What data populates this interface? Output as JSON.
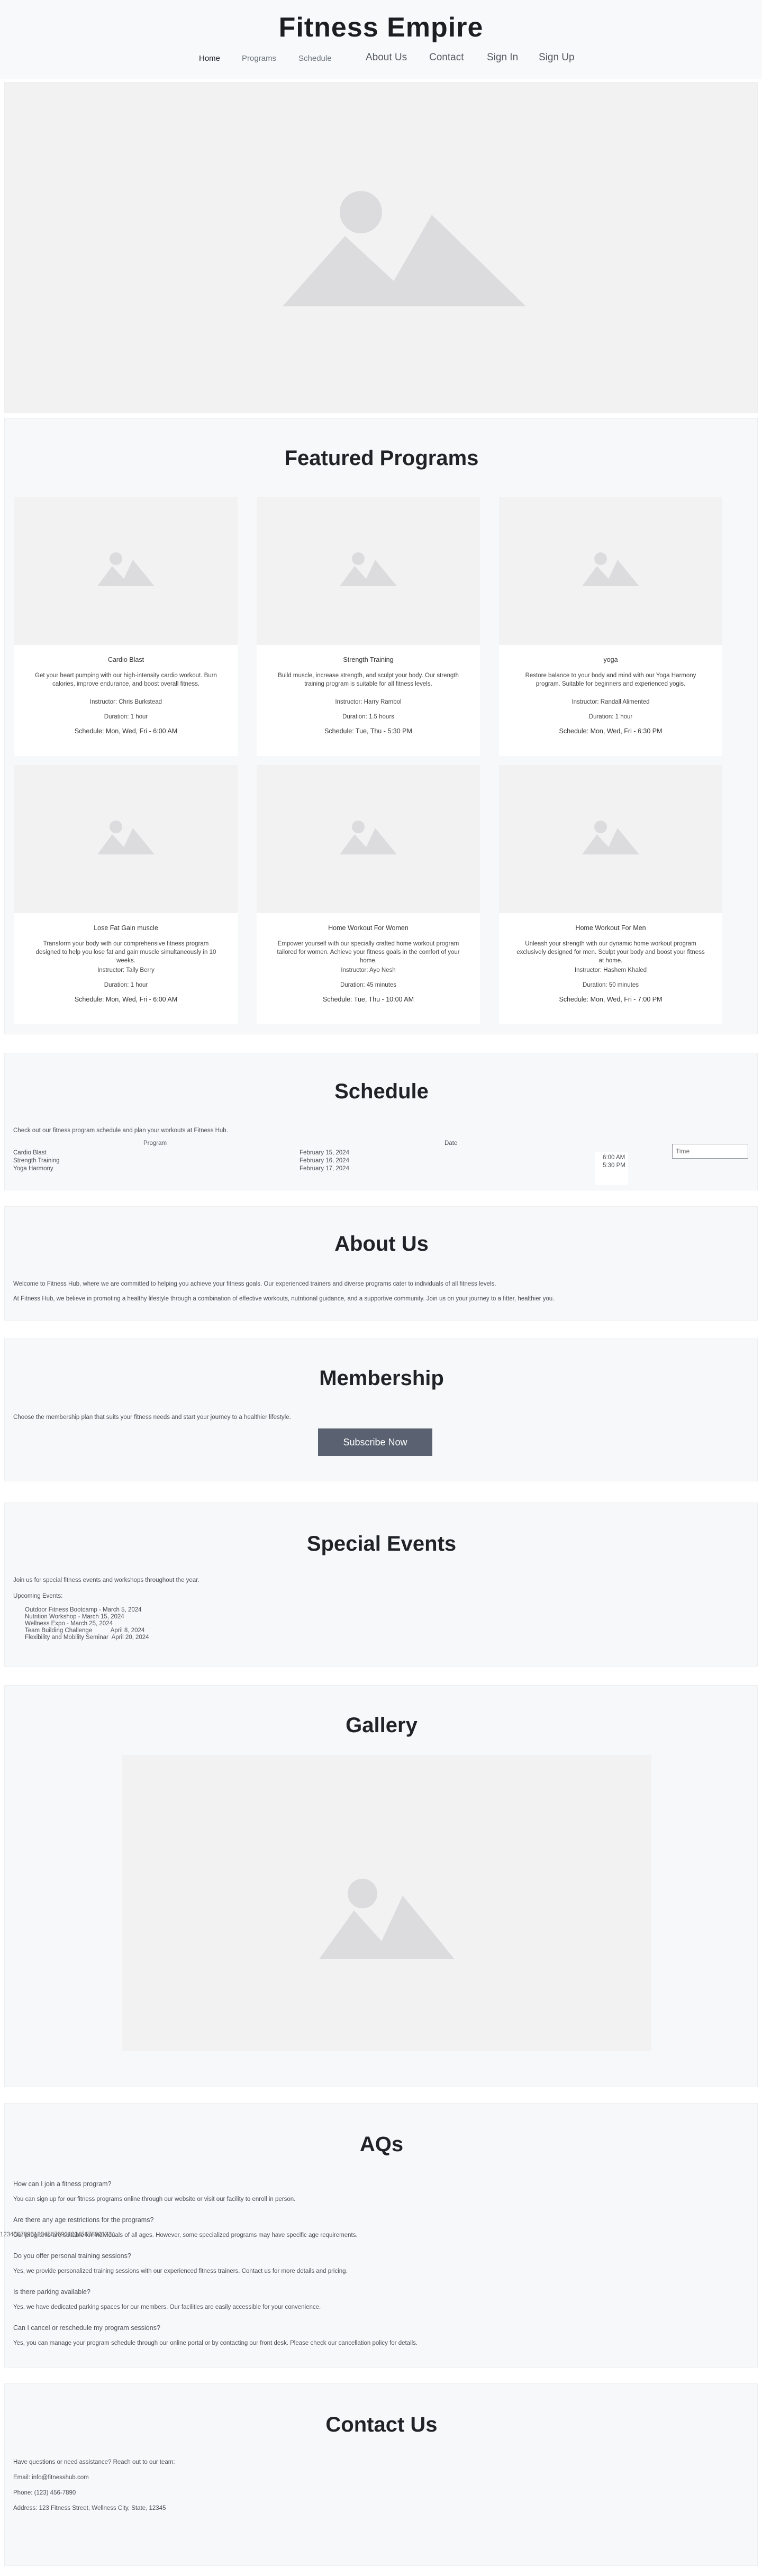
{
  "site": {
    "title": "Fitness Empire"
  },
  "nav": {
    "home": "Home",
    "programs": "Programs",
    "schedule": "Schedule",
    "about": "About Us",
    "contact": "Contact",
    "signin": "Sign In",
    "signup": "Sign Up"
  },
  "featured": {
    "title": "Featured Programs",
    "cards": [
      {
        "name": "Cardio Blast",
        "desc": "Get your heart pumping with our high-intensity cardio workout. Burn calories, improve endurance, and boost overall fitness.",
        "instructor": "Instructor: Chris Burkstead",
        "duration": "Duration: 1 hour",
        "schedule": "Schedule: Mon, Wed, Fri - 6:00 AM"
      },
      {
        "name": "Strength Training",
        "desc": "Build muscle, increase strength, and sculpt your body. Our strength training program is suitable for all fitness levels.",
        "instructor": "Instructor: Harry Rambol",
        "duration": "Duration: 1.5 hours",
        "schedule": "Schedule: Tue, Thu - 5:30 PM"
      },
      {
        "name": "yoga",
        "desc": "Restore balance to your body and mind with our Yoga Harmony program. Suitable for beginners and experienced yogis.",
        "instructor": "Instructor: Randall Alimented",
        "duration": "Duration: 1 hour",
        "schedule": "Schedule: Mon, Wed, Fri - 6:30 PM"
      },
      {
        "name": "Lose Fat Gain muscle",
        "desc": "Transform your body with our comprehensive fitness program designed to help you lose fat and gain muscle simultaneously in 10 weeks.",
        "instructor": "Instructor: Tally Berry",
        "duration": "Duration: 1 hour",
        "schedule": "Schedule: Mon, Wed, Fri - 6:00 AM"
      },
      {
        "name": "Home Workout For Women",
        "desc": "Empower yourself with our specially crafted home workout program tailored for women. Achieve your fitness goals in the comfort of your home.",
        "instructor": "Instructor: Ayo Nesh",
        "duration": "Duration: 45 minutes",
        "schedule": "Schedule: Tue, Thu - 10:00 AM"
      },
      {
        "name": "Home Workout For Men",
        "desc": "Unleash your strength with our dynamic home workout program exclusively designed for men. Sculpt your body and boost your fitness at home.",
        "instructor": "Instructor: Hashem Khaled",
        "duration": "Duration: 50 minutes",
        "schedule": "Schedule: Mon, Wed, Fri - 7:00 PM"
      }
    ]
  },
  "schedule": {
    "title": "Schedule",
    "intro": "Check out our fitness program schedule and plan your workouts at Fitness Hub.",
    "col_program": "Program",
    "col_date": "Date",
    "programs": [
      "Cardio Blast",
      "Strength Training",
      "Yoga Harmony"
    ],
    "dates": [
      "February 15, 2024",
      "February 16, 2024",
      "February 17, 2024"
    ],
    "times": [
      "6:00 AM",
      "5:30 PM"
    ],
    "time_placeholder": "Time"
  },
  "about": {
    "title": "About Us",
    "p1": "Welcome to Fitness Hub, where we are committed to helping you achieve your fitness goals. Our experienced trainers and diverse programs cater to individuals of all fitness levels.",
    "p2": "At Fitness Hub, we believe in promoting a healthy lifestyle through a combination of effective workouts, nutritional guidance, and a supportive community. Join us on your journey to a fitter, healthier you."
  },
  "membership": {
    "title": "Membership",
    "intro": "Choose the membership plan that suits your fitness needs and start your journey to a healthier lifestyle.",
    "button": "Subscribe Now"
  },
  "events": {
    "title": "Special Events",
    "intro": "Join us for special fitness events and workshops throughout the year.",
    "upcoming": "Upcoming Events:",
    "items": [
      "Outdoor Fitness Bootcamp - March 5, 2024",
      "Nutrition Workshop - March 15, 2024",
      "Wellness Expo - March 25, 2024",
      "Team Building Challenge           April 8, 2024",
      "Flexibility and Mobility Seminar  April 20, 2024"
    ]
  },
  "gallery": {
    "title": "Gallery"
  },
  "faq": {
    "title": "AQs",
    "overflow": "1234567890123456789012345678901234",
    "items": [
      {
        "q": "How can I join a fitness program?",
        "a": "You can sign up for our fitness programs online through our website or visit our facility to enroll in person."
      },
      {
        "q": "Are there any age restrictions for the programs?",
        "a": "Our programs are suitable for individuals of all ages. However, some specialized programs may have specific age requirements."
      },
      {
        "q": "Do you offer personal training sessions?",
        "a": "Yes, we provide personalized training sessions with our experienced fitness trainers. Contact us for more details and pricing."
      },
      {
        "q": "Is there parking available?",
        "a": "Yes, we have dedicated parking spaces for our members. Our facilities are easily accessible for your convenience."
      },
      {
        "q": "Can I cancel or reschedule my program sessions?",
        "a": "Yes, you can manage your program schedule through our online portal or by contacting our front desk. Please check our cancellation policy for details."
      }
    ]
  },
  "contact": {
    "title": "Contact Us",
    "intro": "Have questions or need assistance? Reach out to our team:",
    "email": "Email: info@fitnesshub.com",
    "phone": "Phone: (123) 456-7890",
    "address": "Address: 123 Fitness Street, Wellness City, State, 12345"
  },
  "colors": {
    "panel": "#f7f8fa",
    "button": "#5a6170",
    "placeholder": "#dcdcde"
  }
}
